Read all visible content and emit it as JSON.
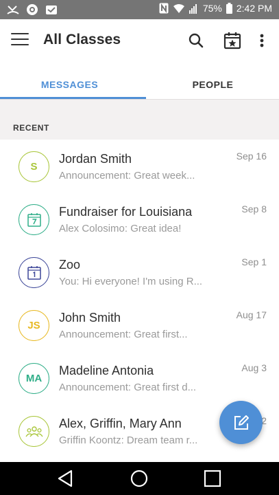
{
  "status_bar": {
    "battery": "75%",
    "time": "2:42 PM",
    "icons": [
      "missed-call-icon",
      "camera-icon",
      "inbox-icon",
      "nfc-icon",
      "wifi-icon",
      "signal-icon",
      "battery-icon"
    ]
  },
  "app_bar": {
    "title": "All Classes",
    "icons": [
      "menu-icon",
      "search-icon",
      "calendar-star-icon",
      "more-vert-icon"
    ]
  },
  "tabs": [
    {
      "label": "MESSAGES",
      "active": true
    },
    {
      "label": "PEOPLE",
      "active": false
    }
  ],
  "section": {
    "label": "RECENT"
  },
  "conversations": [
    {
      "title": "Jordan Smith",
      "preview": "Announcement: Great week...",
      "date": "Sep 16",
      "avatar_text": "S",
      "avatar_icon": "",
      "color": "#a9c63a"
    },
    {
      "title": "Fundraiser for Louisiana",
      "preview": "Alex Colosimo: Great idea!",
      "date": "Sep 8",
      "avatar_text": "",
      "avatar_icon": "calendar-7-icon",
      "color": "#2fae88"
    },
    {
      "title": "Zoo",
      "preview": "You: Hi everyone! I'm using R...",
      "date": "Sep 1",
      "avatar_text": "",
      "avatar_icon": "calendar-1-icon",
      "color": "#3d4799"
    },
    {
      "title": "John Smith",
      "preview": "Announcement: Great first...",
      "date": "Aug 17",
      "avatar_text": "JS",
      "avatar_icon": "",
      "color": "#e8b923"
    },
    {
      "title": "Madeline Antonia",
      "preview": "Announcement: Great first d...",
      "date": "Aug 3",
      "avatar_text": "MA",
      "avatar_icon": "",
      "color": "#2fae88"
    },
    {
      "title": "Alex, Griffin, Mary Ann",
      "preview": "Griffin Koontz: Dream team r...",
      "date": "2",
      "avatar_text": "",
      "avatar_icon": "group-icon",
      "color": "#a9c63a"
    }
  ],
  "colors": {
    "accent": "#4f8fd6",
    "status_bar": "#757575",
    "section_bg": "#f3f1f1"
  },
  "fab": {
    "icon": "compose-icon"
  },
  "nav_bar": {
    "icons": [
      "back-icon",
      "home-icon",
      "recents-icon"
    ]
  }
}
